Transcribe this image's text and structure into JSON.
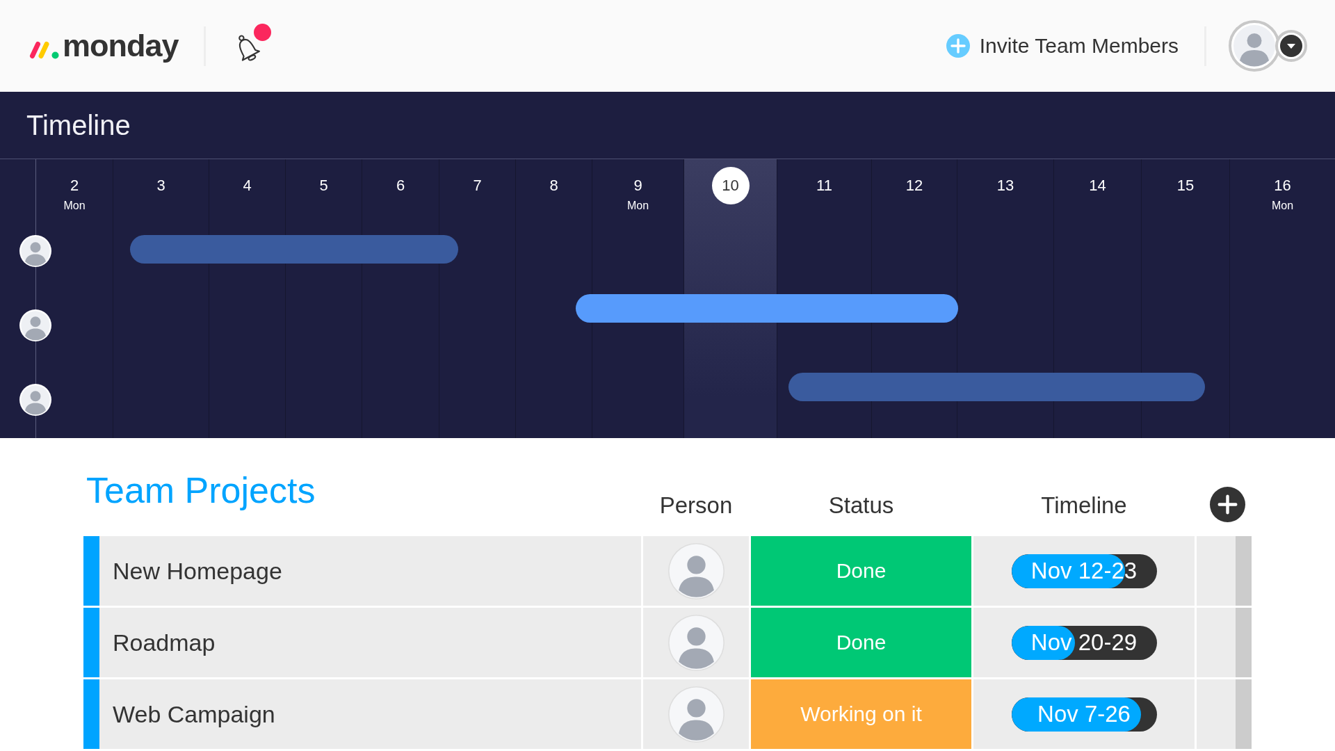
{
  "header": {
    "logo": "monday",
    "notifications": {
      "unread": true
    },
    "invite_button": "Invite Team Members"
  },
  "timeline": {
    "title": "Timeline",
    "days": [
      {
        "number": "2",
        "weekday": "Mon",
        "today": false
      },
      {
        "number": "3",
        "today": false
      },
      {
        "number": "4",
        "today": false
      },
      {
        "number": "5",
        "today": false
      },
      {
        "number": "6",
        "today": false
      },
      {
        "number": "7",
        "today": false
      },
      {
        "number": "8",
        "today": false
      },
      {
        "number": "9",
        "weekday": "Mon",
        "today": false
      },
      {
        "number": "10",
        "today": true
      },
      {
        "number": "11",
        "today": false
      },
      {
        "number": "12",
        "today": false
      },
      {
        "number": "13",
        "today": false
      },
      {
        "number": "14",
        "today": false
      },
      {
        "number": "15",
        "today": false
      },
      {
        "number": "16",
        "weekday": "Mon",
        "today": false
      }
    ],
    "rows": [
      {
        "selected": false
      },
      {
        "selected": true
      },
      {
        "selected": false
      }
    ]
  },
  "board": {
    "title": "Team Projects",
    "columns": [
      "Person",
      "Status",
      "Timeline"
    ],
    "rows": [
      {
        "name": "New Homepage",
        "status": {
          "label": "Done",
          "color": "#00c875"
        },
        "timeline": {
          "label": "Nov 12-23",
          "level": 0.78
        }
      },
      {
        "name": "Roadmap",
        "status": {
          "label": "Done",
          "color": "#00c875"
        },
        "timeline": {
          "label": "Nov 20-29",
          "level": 0.44
        }
      },
      {
        "name": "Web Campaign",
        "status": {
          "label": "Working on it",
          "color": "#fdab3d"
        },
        "timeline": {
          "label": "Nov 7-26",
          "level": 0.89
        }
      }
    ]
  }
}
